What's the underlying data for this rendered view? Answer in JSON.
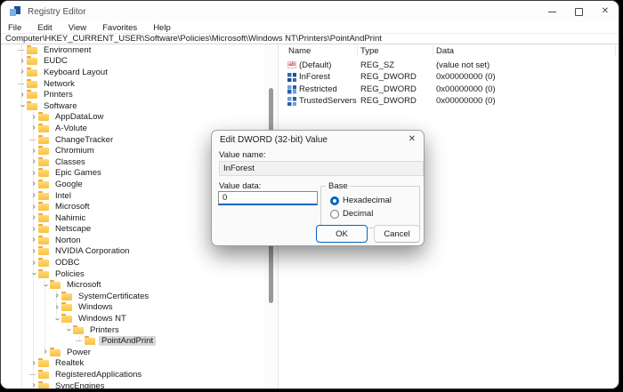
{
  "window": {
    "title": "Registry Editor"
  },
  "menu": {
    "items": [
      "File",
      "Edit",
      "View",
      "Favorites",
      "Help"
    ]
  },
  "address": {
    "path": "Computer\\HKEY_CURRENT_USER\\Software\\Policies\\Microsoft\\Windows NT\\Printers\\PointAndPrint"
  },
  "tree": {
    "items": [
      {
        "label": "Environment",
        "level": 1,
        "state": "leaf"
      },
      {
        "label": "EUDC",
        "level": 1,
        "state": "closed"
      },
      {
        "label": "Keyboard Layout",
        "level": 1,
        "state": "closed"
      },
      {
        "label": "Network",
        "level": 1,
        "state": "leaf"
      },
      {
        "label": "Printers",
        "level": 1,
        "state": "closed"
      },
      {
        "label": "Software",
        "level": 1,
        "state": "open"
      },
      {
        "label": "AppDataLow",
        "level": 2,
        "state": "closed"
      },
      {
        "label": "A-Volute",
        "level": 2,
        "state": "closed"
      },
      {
        "label": "ChangeTracker",
        "level": 2,
        "state": "leaf"
      },
      {
        "label": "Chromium",
        "level": 2,
        "state": "closed"
      },
      {
        "label": "Classes",
        "level": 2,
        "state": "closed"
      },
      {
        "label": "Epic Games",
        "level": 2,
        "state": "closed"
      },
      {
        "label": "Google",
        "level": 2,
        "state": "closed"
      },
      {
        "label": "Intel",
        "level": 2,
        "state": "closed"
      },
      {
        "label": "Microsoft",
        "level": 2,
        "state": "closed"
      },
      {
        "label": "Nahimic",
        "level": 2,
        "state": "closed"
      },
      {
        "label": "Netscape",
        "level": 2,
        "state": "closed"
      },
      {
        "label": "Norton",
        "level": 2,
        "state": "closed"
      },
      {
        "label": "NVIDIA Corporation",
        "level": 2,
        "state": "closed"
      },
      {
        "label": "ODBC",
        "level": 2,
        "state": "closed"
      },
      {
        "label": "Policies",
        "level": 2,
        "state": "open"
      },
      {
        "label": "Microsoft",
        "level": 3,
        "state": "open"
      },
      {
        "label": "SystemCertificates",
        "level": 4,
        "state": "closed"
      },
      {
        "label": "Windows",
        "level": 4,
        "state": "closed"
      },
      {
        "label": "Windows NT",
        "level": 4,
        "state": "open"
      },
      {
        "label": "Printers",
        "level": 5,
        "state": "open"
      },
      {
        "label": "PointAndPrint",
        "level": 6,
        "state": "leaf",
        "selected": true
      },
      {
        "label": "Power",
        "level": 3,
        "state": "closed"
      },
      {
        "label": "Realtek",
        "level": 2,
        "state": "closed"
      },
      {
        "label": "RegisteredApplications",
        "level": 2,
        "state": "leaf"
      },
      {
        "label": "SyncEngines",
        "level": 2,
        "state": "closed"
      }
    ]
  },
  "values": {
    "columns": [
      "Name",
      "Type",
      "Data"
    ],
    "sz_glyph": "ab",
    "rows": [
      {
        "name": "(Default)",
        "type": "REG_SZ",
        "data": "(value not set)",
        "selected": false
      },
      {
        "name": "InForest",
        "type": "REG_DWORD",
        "data": "0x00000000 (0)",
        "selected": true
      },
      {
        "name": "Restricted",
        "type": "REG_DWORD",
        "data": "0x00000000 (0)",
        "selected": false
      },
      {
        "name": "TrustedServers",
        "type": "REG_DWORD",
        "data": "0x00000000 (0)",
        "selected": false
      }
    ]
  },
  "dialog": {
    "title": "Edit DWORD (32-bit) Value",
    "value_name_label": "Value name:",
    "value_name": "InForest",
    "value_data_label": "Value data:",
    "value_data": "0",
    "base_label": "Base",
    "radios": [
      {
        "label": "Hexadecimal",
        "selected": true
      },
      {
        "label": "Decimal",
        "selected": false
      }
    ],
    "ok_label": "OK",
    "cancel_label": "Cancel"
  },
  "colors": {
    "accent": "#0067c0",
    "selection": "#d7d7d7",
    "folder": "#f9c240"
  }
}
